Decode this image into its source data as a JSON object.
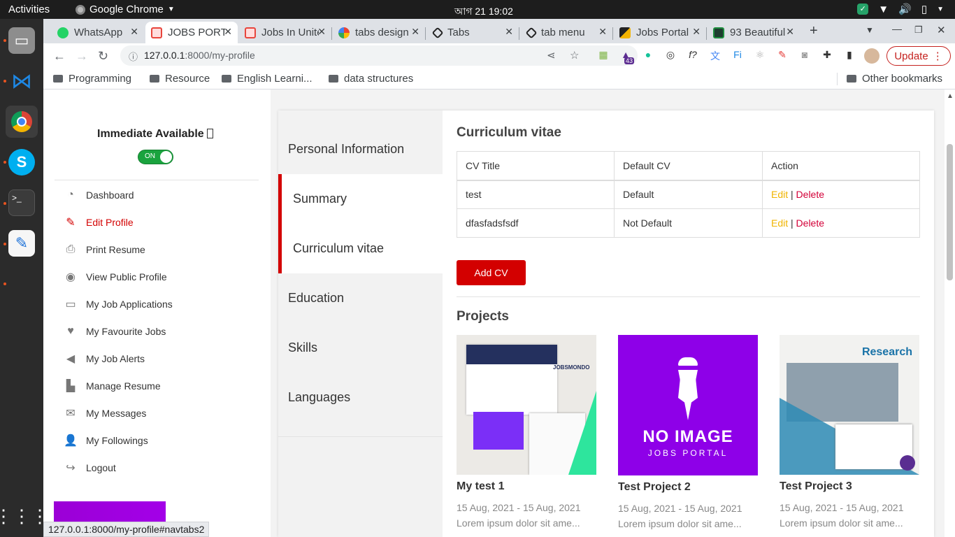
{
  "os": {
    "activities": "Activities",
    "app_name": "Google Chrome",
    "clock": "আগ 21  19:02"
  },
  "browser": {
    "tabs": [
      {
        "title": "WhatsApp",
        "color": "#25d366"
      },
      {
        "title": "JOBS PORTAL",
        "color": "#e8453c"
      },
      {
        "title": "Jobs In United",
        "color": "#e8453c"
      },
      {
        "title": "tabs design",
        "color": "#4285f4"
      },
      {
        "title": "Tabs",
        "color": "#222222"
      },
      {
        "title": "tab menu",
        "color": "#222222"
      },
      {
        "title": "Jobs Portal",
        "color": "#222222"
      },
      {
        "title": "93 Beautiful",
        "color": "#1e8e3e"
      }
    ],
    "url_host": "127.0.0.1",
    "url_path": ":8000/my-profile",
    "update_label": "Update",
    "extension_badge": "43",
    "bookmarks": [
      "Programming",
      "Resource",
      "English Learni...",
      "data structures"
    ],
    "other_bookmarks": "Other bookmarks",
    "status_url": "127.0.0.1:8000/my-profile#navtabs2"
  },
  "sidebar": {
    "availability_label": "Immediate Available ",
    "toggle_label": "ON",
    "menu": [
      {
        "label": "Dashboard",
        "icon": "dashboard-icon"
      },
      {
        "label": "Edit Profile",
        "icon": "pencil-icon",
        "active": true
      },
      {
        "label": "Print Resume",
        "icon": "printer-icon"
      },
      {
        "label": "View Public Profile",
        "icon": "eye-icon"
      },
      {
        "label": "My Job Applications",
        "icon": "desktop-icon"
      },
      {
        "label": "My Favourite Jobs",
        "icon": "heart-icon"
      },
      {
        "label": "My Job Alerts",
        "icon": "megaphone-icon"
      },
      {
        "label": "Manage Resume",
        "icon": "file-icon"
      },
      {
        "label": "My Messages",
        "icon": "envelope-icon"
      },
      {
        "label": "My Followings",
        "icon": "user-icon"
      },
      {
        "label": "Logout",
        "icon": "logout-icon"
      }
    ]
  },
  "profile_tabs": [
    "Personal Information",
    "Summary",
    "Curriculum vitae",
    "Education",
    "Skills",
    "Languages"
  ],
  "cv": {
    "title": "Curriculum vitae",
    "headers": [
      "CV Title",
      "Default CV",
      "Action"
    ],
    "rows": [
      {
        "title": "test",
        "default": "Default",
        "edit": "Edit",
        "sep": "|",
        "delete": "Delete"
      },
      {
        "title": "dfasfadsfsdf",
        "default": "Not Default",
        "edit": "Edit",
        "sep": "|",
        "delete": "Delete"
      }
    ],
    "add_button": "Add CV"
  },
  "projects": {
    "title": "Projects",
    "items": [
      {
        "name": "My test 1",
        "date": "15 Aug, 2021 - 15 Aug, 2021",
        "desc": "Lorem ipsum dolor sit ame...",
        "thumb_text": "JOBSMONDO"
      },
      {
        "name": "Test Project 2",
        "date": "15 Aug, 2021 - 15 Aug, 2021",
        "desc": "Lorem ipsum dolor sit ame...",
        "thumb_line1": "NO IMAGE",
        "thumb_line2": "JOBS PORTAL"
      },
      {
        "name": "Test Project 3",
        "date": "15 Aug, 2021 - 15 Aug, 2021",
        "desc": "Lorem ipsum dolor sit ame...",
        "thumb_text": "Research"
      }
    ]
  },
  "colors": {
    "accent": "#d30000",
    "toggle": "#1aa33e",
    "purple": "#8e00e8"
  }
}
